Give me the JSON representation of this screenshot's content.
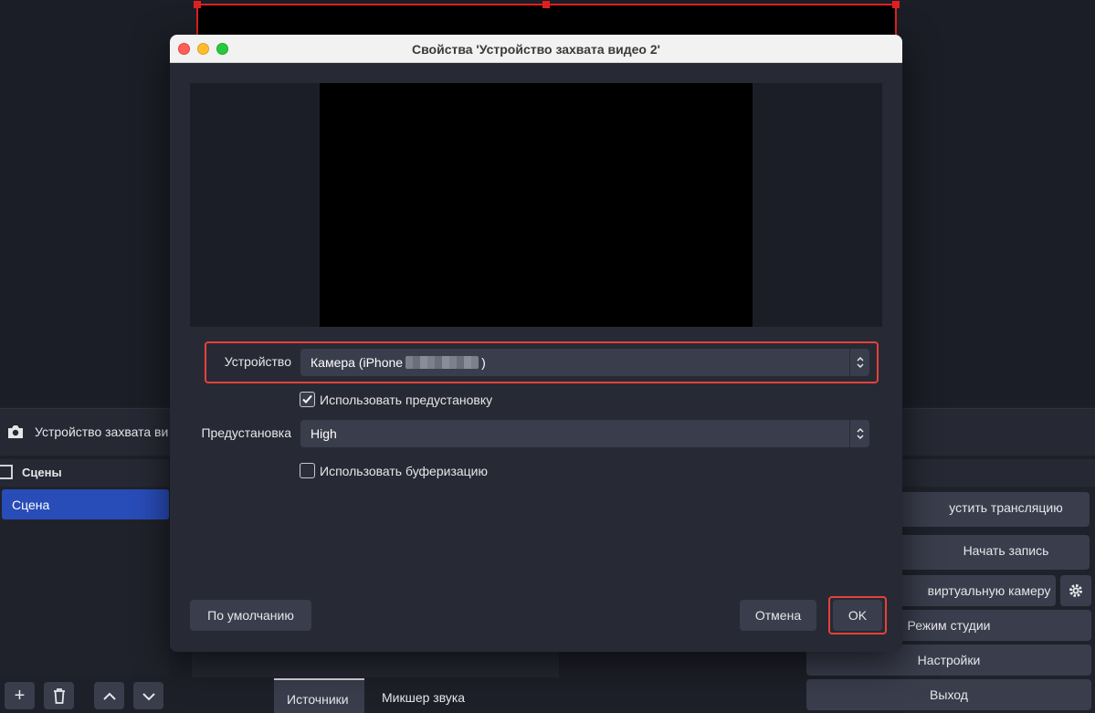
{
  "background": {
    "source_name": "Устройство захвата ви",
    "scenes_header": "Сцены",
    "scene_item": "Сцена",
    "tabs": [
      "Источники",
      "Микшер звука"
    ],
    "controls": {
      "start_stream": "устить трансляцию",
      "start_record": "Начать запись",
      "virtual_cam": "виртуальную камеру",
      "studio_mode": "Режим студии",
      "settings": "Настройки",
      "exit": "Выход"
    },
    "scene_tools": {
      "add": "+",
      "remove": "🗑",
      "up": "︿",
      "down": "﹀"
    }
  },
  "dialog": {
    "title": "Свойства 'Устройство захвата видео 2'",
    "device_label": "Устройство",
    "device_value_prefix": "Камера (iPhone",
    "device_value_suffix": ")",
    "use_preset_label": "Использовать предустановку",
    "use_preset_checked": true,
    "preset_label": "Предустановка",
    "preset_value": "High",
    "buffering_label": "Использовать буферизацию",
    "buffering_checked": false,
    "defaults_button": "По умолчанию",
    "cancel_button": "Отмена",
    "ok_button": "OK"
  },
  "colors": {
    "accent_blue": "#284cb8",
    "highlight_red": "#e5413b",
    "selection_red": "#e02020"
  }
}
